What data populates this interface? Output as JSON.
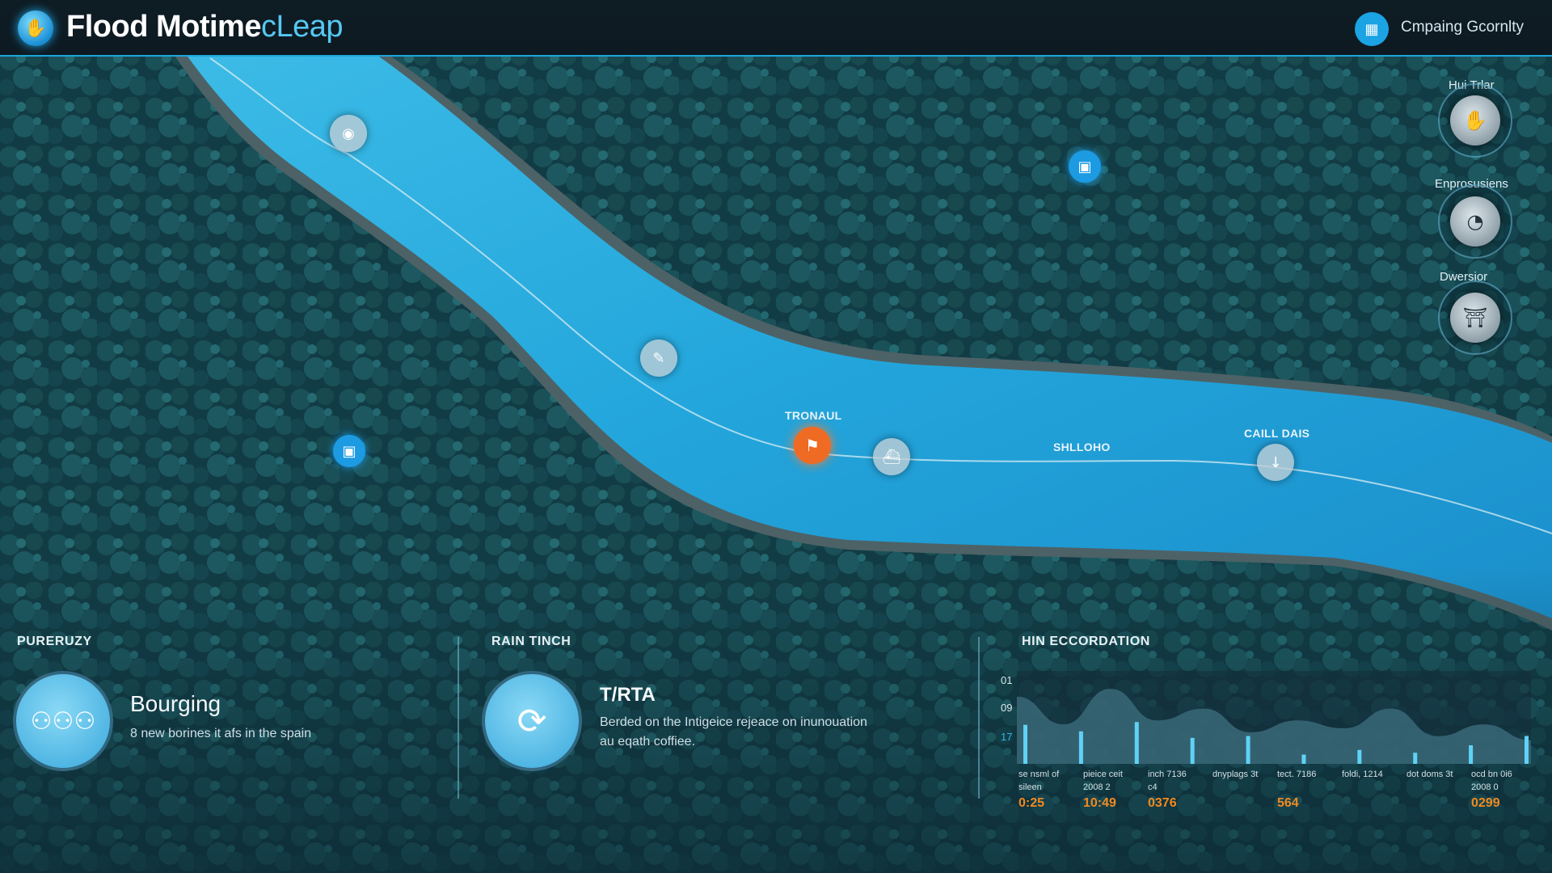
{
  "app": {
    "title_main": "Flood Motime",
    "title_accent": "cLeap",
    "account_label": "Cmpaing Gcornlty"
  },
  "colors": {
    "accent": "#1ea6dc",
    "river": "#27a9dd",
    "forest": "#123f47",
    "alert": "#ef6a22"
  },
  "controls": [
    {
      "label": "Hui Trlar",
      "icon": "hand-shield-icon"
    },
    {
      "label": "Enprosusiens",
      "icon": "gauge-icon"
    },
    {
      "label": "Dwersior",
      "icon": "dam-icon"
    }
  ],
  "map": {
    "labels": {
      "alert": "TRONAUL",
      "sensor": "SHLLOHO",
      "gauge": "CAILL DAIS"
    }
  },
  "panels": {
    "left": {
      "title": "PURERUZY",
      "heading": "Bourging",
      "text": "8 new borines it afs in the spain"
    },
    "middle": {
      "title": "RAIN TINCH",
      "heading": "T/RTA",
      "text_line1": "Berded on the Intigeice rejeace on inunouation",
      "text_line2": "au eqath coffiee."
    },
    "right": {
      "title": "HIN ECCORDATION"
    }
  },
  "chart_data": {
    "type": "area",
    "title": "HIN ECCORDATION",
    "y_ticks": [
      "01",
      "09",
      "17"
    ],
    "x_labels": [
      {
        "line1": "se nsml of",
        "line2": "sileen",
        "value": "0:25"
      },
      {
        "line1": "pieice ceit",
        "line2": "2008 2",
        "value": "10:49"
      },
      {
        "line1": "inch 7136",
        "line2": "c4",
        "value": "0376"
      },
      {
        "line1": "dnyplags 3t",
        "line2": "",
        "value": ""
      },
      {
        "line1": "tect. 7186",
        "line2": "",
        "value": "564"
      },
      {
        "line1": "foldi, 1214",
        "line2": "",
        "value": ""
      },
      {
        "line1": "dot doms 3t",
        "line2": "",
        "value": ""
      },
      {
        "line1": "ocd bn 0i6",
        "line2": "2008 0",
        "value": "0299"
      }
    ],
    "series": [
      {
        "values": [
          0.85,
          0.5,
          0.95,
          0.55,
          0.7,
          0.4,
          0.55,
          0.45,
          0.7,
          0.35,
          0.5,
          0.3
        ]
      }
    ],
    "bars": [
      0.42,
      0.35,
      0.45,
      0.28,
      0.3,
      0.1,
      0.15,
      0.12,
      0.2,
      0.3
    ],
    "ylim": [
      0,
      1
    ]
  }
}
